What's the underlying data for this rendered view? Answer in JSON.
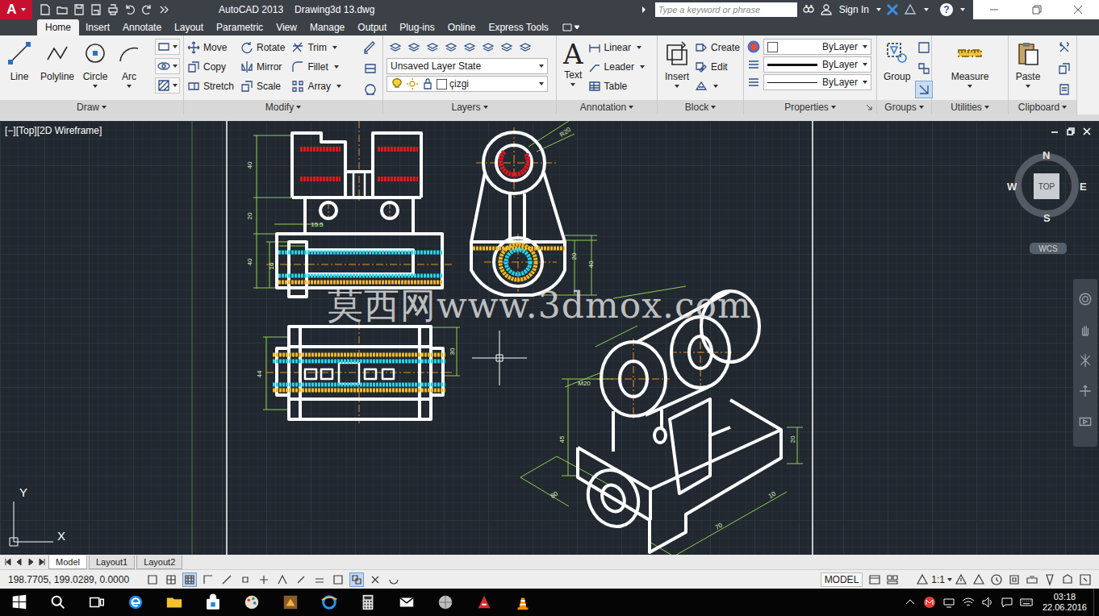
{
  "title_bar": {
    "logo": "A",
    "app": "AutoCAD 2013",
    "document": "Drawing3d 13.dwg",
    "search_placeholder": "Type a keyword or phrase",
    "sign_in": "Sign In",
    "help": "?"
  },
  "ribbon_tabs": [
    {
      "label": "Home",
      "selected": true
    },
    {
      "label": "Insert",
      "selected": false
    },
    {
      "label": "Annotate",
      "selected": false
    },
    {
      "label": "Layout",
      "selected": false
    },
    {
      "label": "Parametric",
      "selected": false
    },
    {
      "label": "View",
      "selected": false
    },
    {
      "label": "Manage",
      "selected": false
    },
    {
      "label": "Output",
      "selected": false
    },
    {
      "label": "Plug-ins",
      "selected": false
    },
    {
      "label": "Online",
      "selected": false
    },
    {
      "label": "Express Tools",
      "selected": false
    }
  ],
  "panels": {
    "draw": {
      "title": "Draw",
      "menu": true,
      "tools": [
        {
          "label": "Line",
          "dropdown": false
        },
        {
          "label": "Polyline",
          "dropdown": false
        },
        {
          "label": "Circle",
          "dropdown": true
        },
        {
          "label": "Arc",
          "dropdown": true
        }
      ]
    },
    "modify": {
      "title": "Modify",
      "menu": true,
      "tools": [
        {
          "label": "Move",
          "dropdown": false
        },
        {
          "label": "Rotate",
          "dropdown": false
        },
        {
          "label": "Trim",
          "dropdown": true
        },
        {
          "label": "Copy",
          "dropdown": false
        },
        {
          "label": "Mirror",
          "dropdown": false
        },
        {
          "label": "Fillet",
          "dropdown": true
        },
        {
          "label": "Stretch",
          "dropdown": false
        },
        {
          "label": "Scale",
          "dropdown": false
        },
        {
          "label": "Array",
          "dropdown": true
        }
      ]
    },
    "layers": {
      "title": "Layers",
      "menu": true,
      "layer_state": "Unsaved Layer State",
      "current_layer": "çizgi"
    },
    "annotation": {
      "title": "Annotation",
      "menu": true,
      "big_tool": "Text",
      "big_glyph": "A",
      "tools": [
        {
          "label": "Linear",
          "dropdown": true
        },
        {
          "label": "Leader",
          "dropdown": true
        },
        {
          "label": "Table",
          "dropdown": false
        }
      ]
    },
    "block": {
      "title": "Block",
      "menu": true,
      "big_tool": "Insert",
      "tools": [
        {
          "label": "Create"
        },
        {
          "label": "Edit"
        }
      ]
    },
    "properties": {
      "title": "Properties",
      "menu": true,
      "rows": [
        {
          "value": "ByLayer",
          "kind": "color"
        },
        {
          "value": "ByLayer",
          "kind": "lineweight"
        },
        {
          "value": "ByLayer",
          "kind": "linetype"
        }
      ]
    },
    "groups": {
      "title": "Groups",
      "menu": true,
      "big_tool": "Group"
    },
    "utilities": {
      "title": "Utilities",
      "menu": true,
      "big_tool": "Measure"
    },
    "clipboard": {
      "title": "Clipboard",
      "menu": true,
      "big_tool": "Paste"
    }
  },
  "viewport": {
    "label": "[−][Top][2D Wireframe]",
    "viewcube": {
      "north": "N",
      "south": "S",
      "west": "W",
      "east": "E",
      "face": "TOP",
      "ucs": "WCS"
    },
    "ucs_axes": {
      "x": "X",
      "y": "Y"
    },
    "watermark": "莫西网www.3dmox.com",
    "dimensions": [
      "40",
      "20",
      "40",
      "10",
      "15.5",
      "20",
      "40",
      "R20",
      "44",
      "30",
      "M20",
      "45",
      "80",
      "70",
      "20",
      "10"
    ]
  },
  "layout_tabs": [
    {
      "label": "Model",
      "selected": true
    },
    {
      "label": "Layout1",
      "selected": false
    },
    {
      "label": "Layout2",
      "selected": false
    }
  ],
  "status_bar": {
    "coordinates": "198.7705, 199.0289, 0.0000",
    "toggles": [
      {
        "on": false
      },
      {
        "on": false
      },
      {
        "on": true
      },
      {
        "on": false
      },
      {
        "on": false
      },
      {
        "on": false
      },
      {
        "on": false
      },
      {
        "on": false
      },
      {
        "on": false
      },
      {
        "on": false
      },
      {
        "on": false
      },
      {
        "on": true
      },
      {
        "on": false
      },
      {
        "on": false
      }
    ],
    "space": "MODEL",
    "annotation_scale": "1:1"
  },
  "taskbar": {
    "time": "03:18",
    "date": "22.06.2016"
  }
}
